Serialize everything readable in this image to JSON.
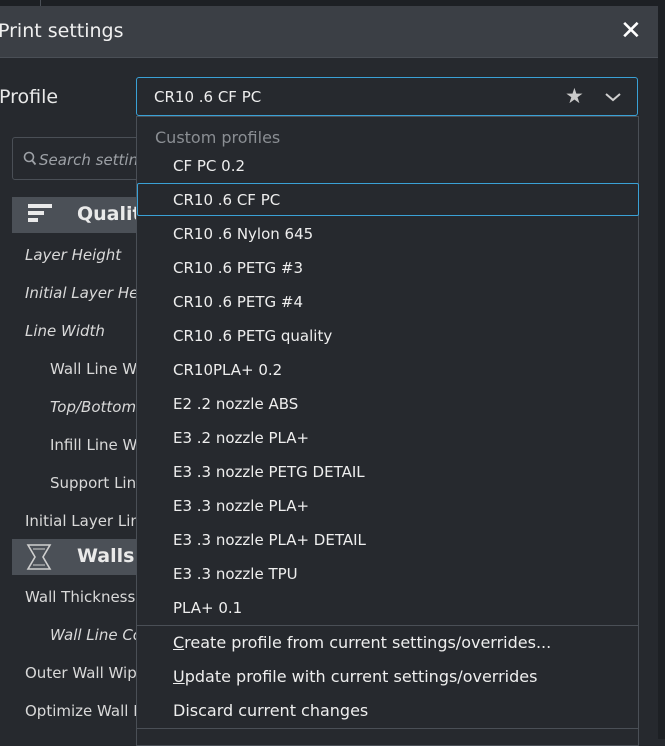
{
  "window": {
    "title": "Print settings",
    "close_symbol": "✕"
  },
  "profile": {
    "label": "Profile",
    "current": "CR10 .6 CF PC",
    "favorite_icon": "star-icon",
    "dropdown_icon": "chevron-down-icon"
  },
  "search": {
    "placeholder": "Search settings",
    "icon": "search-icon"
  },
  "sections": {
    "quality": {
      "label": "Quality",
      "icon": "quality-lines-icon"
    },
    "walls": {
      "label": "Walls",
      "icon": "walls-icon"
    }
  },
  "settings": [
    {
      "label": "Layer Height"
    },
    {
      "label": "Initial Layer Height"
    },
    {
      "label": "Line Width"
    },
    {
      "label": "Wall Line Width"
    },
    {
      "label": "Top/Bottom Line Width"
    },
    {
      "label": "Infill Line Width"
    },
    {
      "label": "Support Line Width"
    },
    {
      "label": "Initial Layer Line Width"
    },
    {
      "label": "Wall Thickness"
    },
    {
      "label": "Wall Line Count"
    },
    {
      "label": "Outer Wall Wipe Distance"
    },
    {
      "label": "Optimize Wall Printing Order"
    }
  ],
  "dropdown": {
    "group_label": "Custom profiles",
    "items": [
      "CF PC 0.2",
      "CR10 .6 CF PC",
      "CR10 .6 Nylon 645",
      "CR10 .6 PETG #3",
      "CR10 .6 PETG #4",
      "CR10 .6 PETG quality",
      "CR10PLA+ 0.2",
      "E2 .2 nozzle ABS",
      "E3 .2 nozzle PLA+",
      "E3 .3 nozzle PETG DETAIL",
      "E3 .3 nozzle PLA+",
      "E3 .3 nozzle PLA+ DETAIL",
      "E3 .3 nozzle TPU",
      "PLA+ 0.1"
    ],
    "selected": "CR10 .6 CF PC",
    "actions": {
      "create": {
        "first": "C",
        "rest": "reate profile from current settings/overrides..."
      },
      "update": {
        "first": "U",
        "rest": "pdate profile with current settings/overrides"
      },
      "discard": "Discard current changes"
    }
  },
  "colors": {
    "background": "#26292e",
    "titlebar": "#3b3f45",
    "accent": "#3aa1d6",
    "section_header": "#4b5057"
  }
}
